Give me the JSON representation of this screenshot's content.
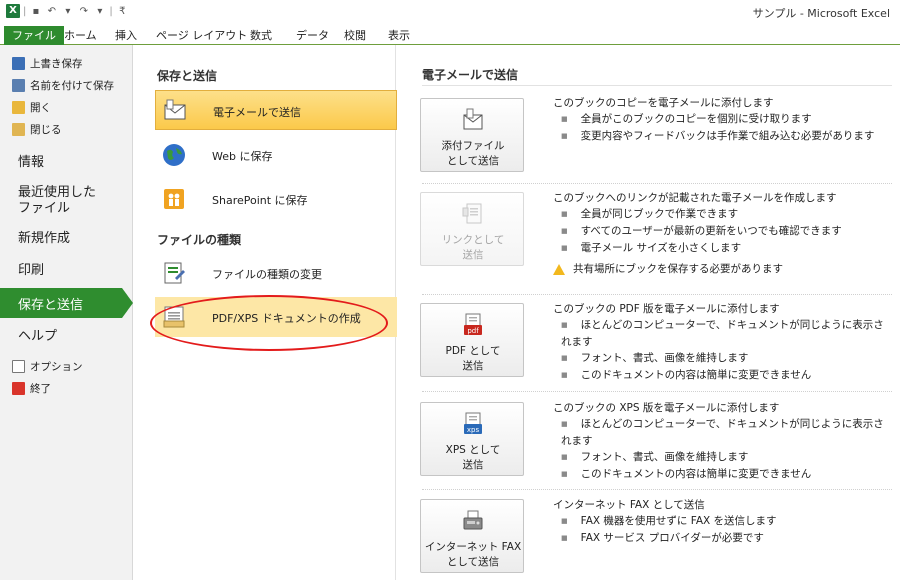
{
  "window": {
    "app_title": "サンプル - Microsoft Excel",
    "app_icon": "X"
  },
  "ribbon": {
    "tabs": [
      {
        "label": "ファイル"
      },
      {
        "label": "ホーム"
      },
      {
        "label": "挿入"
      },
      {
        "label": "ページ レイアウト"
      },
      {
        "label": "数式"
      },
      {
        "label": "データ"
      },
      {
        "label": "校閲"
      },
      {
        "label": "表示"
      }
    ]
  },
  "leftnav": {
    "small_items": [
      {
        "label": "上書き保存",
        "icon": "save-icon"
      },
      {
        "label": "名前を付けて保存",
        "icon": "save-as-icon"
      },
      {
        "label": "開く",
        "icon": "open-folder-icon"
      },
      {
        "label": "閉じる",
        "icon": "close-folder-icon"
      }
    ],
    "big_items": [
      {
        "label": "情報"
      },
      {
        "label": "最近使用した\nファイル"
      },
      {
        "label": "新規作成"
      },
      {
        "label": "印刷"
      }
    ],
    "active_item": "保存と送信",
    "after_items": [
      {
        "label": "ヘルプ"
      }
    ],
    "bottom_items": [
      {
        "label": "オプション",
        "icon": "options-icon"
      },
      {
        "label": "終了",
        "icon": "exit-icon"
      }
    ]
  },
  "middle": {
    "section1_title": "保存と送信",
    "section1_items": [
      {
        "label": "電子メールで送信",
        "icon": "email-attachment-icon",
        "selected": true
      },
      {
        "label": "Web に保存",
        "icon": "globe-icon"
      },
      {
        "label": "SharePoint に保存",
        "icon": "sharepoint-icon"
      }
    ],
    "section2_title": "ファイルの種類",
    "section2_items": [
      {
        "label": "ファイルの種類の変更",
        "icon": "change-file-type-icon"
      },
      {
        "label": "PDF/XPS ドキュメントの作成",
        "icon": "pdf-xps-icon",
        "hover": true
      }
    ]
  },
  "right": {
    "title": "電子メールで送信",
    "options": [
      {
        "button_line1": "添付ファイル",
        "button_line2": "として送信",
        "icon": "attachment-icon",
        "disabled": false,
        "heading": "このブックのコピーを電子メールに添付します",
        "bullets": [
          "全員がこのブックのコピーを個別に受け取ります",
          "変更内容やフィードバックは手作業で組み込む必要があります"
        ]
      },
      {
        "button_line1": "リンクとして",
        "button_line2": "送信",
        "icon": "link-icon",
        "disabled": true,
        "heading": "このブックへのリンクが記載された電子メールを作成します",
        "bullets": [
          "全員が同じブックで作業できます",
          "すべてのユーザーが最新の更新をいつでも確認できます",
          "電子メール サイズを小さくします"
        ],
        "warning": "共有場所にブックを保存する必要があります"
      },
      {
        "button_line1": "PDF として",
        "button_line2": "送信",
        "icon": "pdf-icon",
        "disabled": false,
        "heading": "このブックの PDF 版を電子メールに添付します",
        "bullets": [
          "ほとんどのコンピューターで、ドキュメントが同じように表示されます",
          "フォント、書式、画像を維持します",
          "このドキュメントの内容は簡単に変更できません"
        ]
      },
      {
        "button_line1": "XPS として",
        "button_line2": "送信",
        "icon": "xps-icon",
        "disabled": false,
        "heading": "このブックの XPS 版を電子メールに添付します",
        "bullets": [
          "ほとんどのコンピューターで、ドキュメントが同じように表示されます",
          "フォント、書式、画像を維持します",
          "このドキュメントの内容は簡単に変更できません"
        ]
      },
      {
        "button_line1": "インターネット FAX",
        "button_line2": "として送信",
        "icon": "fax-icon",
        "disabled": false,
        "heading": "インターネット FAX として送信",
        "bullets": [
          "FAX 機器を使用せずに FAX を送信します",
          "FAX サービス プロバイダーが必要です"
        ]
      }
    ]
  },
  "colors": {
    "accent_green": "#2f8d2f",
    "selection_gold": "#fbc94a",
    "annotation_red": "#e31b1b"
  }
}
